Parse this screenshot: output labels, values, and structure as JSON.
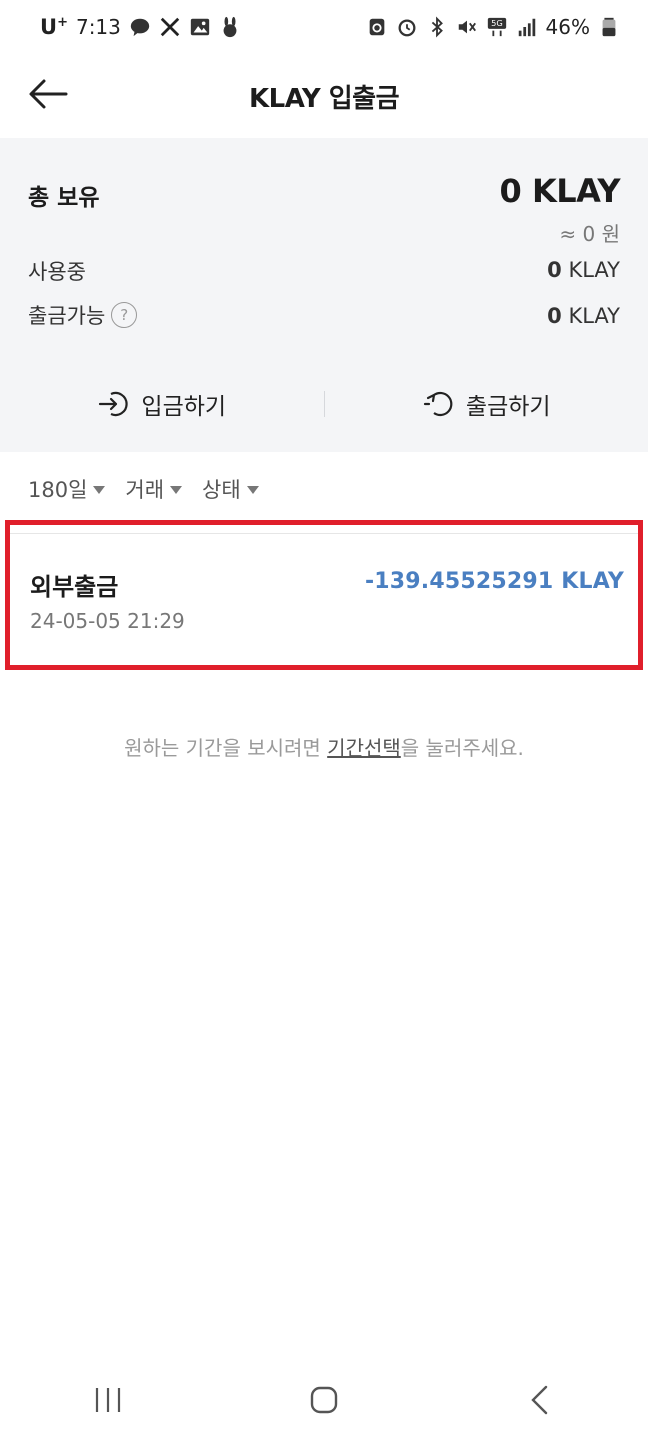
{
  "status_bar": {
    "carrier": "U",
    "carrier_sup": "+",
    "time": "7:13",
    "battery": "46%"
  },
  "header": {
    "title": "KLAY 입출금"
  },
  "summary": {
    "total_label": "총 보유",
    "total_amount": "0 KLAY",
    "total_krw": "≈ 0 원",
    "in_use_label": "사용중",
    "in_use_value": "0",
    "in_use_unit": "KLAY",
    "withdrawable_label": "출금가능",
    "withdrawable_value": "0",
    "withdrawable_unit": "KLAY",
    "deposit_label": "입금하기",
    "withdraw_label": "출금하기"
  },
  "filters": [
    {
      "label": "180일"
    },
    {
      "label": "거래"
    },
    {
      "label": "상태"
    }
  ],
  "transactions": [
    {
      "type": "외부출금",
      "datetime": "24-05-05 21:29",
      "amount": "-139.45525291 KLAY"
    }
  ],
  "hint": {
    "before": "원하는 기간을 보시려면 ",
    "link": "기간선택",
    "after": "을 눌러주세요."
  },
  "colors": {
    "accent_blue": "#4a7fc1",
    "highlight_red": "#e01f2b",
    "panel_bg": "#f4f5f7"
  }
}
